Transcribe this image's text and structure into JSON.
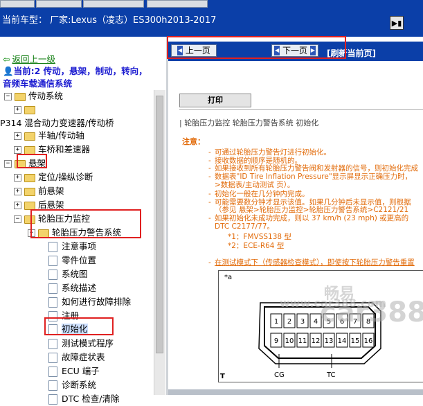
{
  "header": {
    "car_model": "当前车型： 厂家:Lexus（凌志）ES300h2013-2017",
    "exit_icon": "exit-door-icon"
  },
  "sidebar": {
    "back_link": "返回上一级",
    "current_prefix": "当前:2 传动，悬架，制动，转向，音频车载通信系统",
    "tree": [
      {
        "label": "传动系统",
        "kind": "folder",
        "expander": "−"
      },
      {
        "label": "",
        "kind": "folder",
        "expander": "+"
      },
      {
        "label": "P314 混合动力变速器/传动桥",
        "kind": "text",
        "expander": ""
      },
      {
        "label": "半轴/传动轴",
        "kind": "folder",
        "expander": "+"
      },
      {
        "label": "车桥和差速器",
        "kind": "folder",
        "expander": "+"
      },
      {
        "label": "悬架",
        "kind": "folder",
        "expander": "−"
      },
      {
        "label": "定位/操纵诊断",
        "kind": "folder",
        "expander": "+"
      },
      {
        "label": "前悬架",
        "kind": "folder",
        "expander": "+"
      },
      {
        "label": "后悬架",
        "kind": "folder",
        "expander": "+"
      },
      {
        "label": "轮胎压力监控",
        "kind": "folder",
        "expander": "−"
      },
      {
        "label": "轮胎压力警告系统",
        "kind": "folder",
        "expander": "−"
      },
      {
        "label": "注意事项",
        "kind": "doc",
        "expander": ""
      },
      {
        "label": "零件位置",
        "kind": "doc",
        "expander": ""
      },
      {
        "label": "系统图",
        "kind": "doc",
        "expander": ""
      },
      {
        "label": "系统描述",
        "kind": "doc",
        "expander": ""
      },
      {
        "label": "如何进行故障排除",
        "kind": "doc",
        "expander": ""
      },
      {
        "label": "注册",
        "kind": "doc",
        "expander": ""
      },
      {
        "label": "初始化",
        "kind": "doc",
        "expander": ""
      },
      {
        "label": "测试模式程序",
        "kind": "doc",
        "expander": ""
      },
      {
        "label": "故障症状表",
        "kind": "doc",
        "expander": ""
      },
      {
        "label": "ECU 端子",
        "kind": "doc",
        "expander": ""
      },
      {
        "label": "诊断系统",
        "kind": "doc",
        "expander": ""
      },
      {
        "label": "DTC 检查/清除",
        "kind": "doc",
        "expander": ""
      }
    ]
  },
  "nav": {
    "prev_label": "上一页",
    "next_label": "下一页",
    "refresh_label": "[刷新当前页]"
  },
  "content": {
    "print_label": "打印",
    "breadcrumb": "轮胎压力监控  轮胎压力警告系统  初始化",
    "note_title": "注意：",
    "notes": [
      "可通过轮胎压力警告灯进行初始化。",
      "接收数据的顺序是随机的。",
      "如果接收到所有轮胎压力警告阀和发射器的信号，则初始化完成",
      "数据表\"ID Tire Inflation Pressure\"显示屏显示正确压力时，",
      ">数据表/主动测试 页）。",
      "初始化一般在几分钟内完成。",
      "可能需要数分钟才显示该值。如果几分钟后未显示值，则根据",
      "（参见 悬架>轮胎压力监控>轮胎压力警告系统>C2121/21",
      "如果初始化未成功完成，则以 37 km/h (23 mph) 或更高的",
      "DTC C2177/77。"
    ],
    "footnotes": [
      "*1：FMVSS138 型",
      "*2：ECE-R64 型"
    ],
    "bottom_note": "在测试模式下（传感器检查模式），即使按下轮胎压力警告重置",
    "figure": {
      "corner_top": "*a",
      "corner_bottom": "T",
      "pins_top": [
        "1",
        "2",
        "3",
        "4",
        "5",
        "6",
        "7",
        "8"
      ],
      "pins_bottom": [
        "9",
        "10",
        "11",
        "12",
        "13",
        "14",
        "15",
        "16"
      ],
      "label_cg": "CG",
      "label_tc": "TC"
    }
  },
  "watermarks": {
    "mark_1": "畅易",
    "mark_2": "car388",
    "mark_3": "www.car388.com"
  }
}
